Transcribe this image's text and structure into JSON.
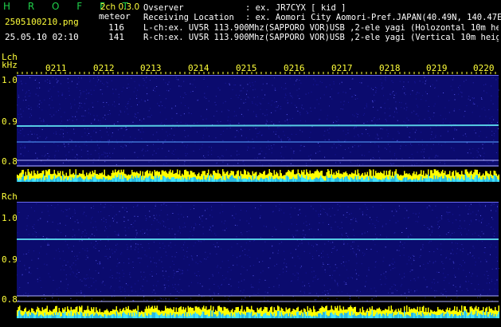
{
  "header": {
    "brand": "H R O F F T",
    "mode": "2ch 0.3.0",
    "filename": "2505100210.png",
    "datetime": "25.05.10 02:10",
    "meteor_label": "meteor",
    "lch_count": "116",
    "rch_count": "141",
    "observer_label": "Ovserver",
    "observer_value": ": ex. JR7CYX [ kid ]",
    "location_label": "Receiving Location",
    "location_value": ": ex. Aomori City Aomori-Pref.JAPAN(40.49N, 140.47E)",
    "lch_info": "L-ch:ex. UV5R 113.900Mhz(SAPPORO VOR)USB ,2-ele yagi (Holozontal 10m height",
    "rch_info": "R-ch:ex. UV5R 113.900Mhz(SAPPORO VOR)USB ,2-ele yagi (Vertical 10m height"
  },
  "time_axis": {
    "labels": [
      "0211",
      "0212",
      "0213",
      "0214",
      "0215",
      "0216",
      "0217",
      "0218",
      "0219",
      "0220"
    ]
  },
  "lch_panel": {
    "channel_label": "Lch",
    "unit_label": "kHz",
    "y_ticks": [
      "1.0",
      "0.9",
      "0.8"
    ]
  },
  "rch_panel": {
    "channel_label": "Rch",
    "y_ticks": [
      "1.0",
      "0.9",
      "0.8"
    ]
  },
  "colors": {
    "background": "#000000",
    "waterfall": "#0b0b6e",
    "text_yellow": "#ffff3a",
    "brand_green": "#1fd04a",
    "signal_cyan": "#5fe0f0",
    "level_yellow": "#ffff00",
    "level_cyan": "#40e0ff"
  }
}
